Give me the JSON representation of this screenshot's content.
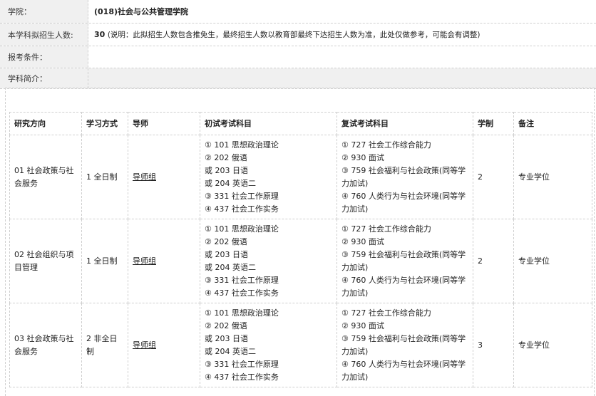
{
  "info": {
    "college_label": "学院：",
    "college_value": "(018)社会与公共管理学院",
    "enroll_label": "本学科拟招生人数:",
    "enroll_num": "30",
    "enroll_note": "(说明：此拟招生人数包含推免生，最终招生人数以教育部最终下达招生人数为准，此处仅做参考，可能会有调整)",
    "conditions_label": "报考条件：",
    "intro_label": "学科简介："
  },
  "table": {
    "headers": [
      "研究方向",
      "学习方式",
      "导师",
      "初试考试科目",
      "复试考试科目",
      "学制",
      "备注"
    ],
    "rows": [
      {
        "direction": "01 社会政策与社会服务",
        "mode": "1 全日制",
        "tutor": "导师组",
        "initial": [
          "① 101 思想政治理论",
          "② 202 俄语",
          "或 203 日语",
          "或 204 英语二",
          "③ 331 社会工作原理",
          "④ 437 社会工作实务"
        ],
        "retest": [
          "① 727 社会工作综合能力",
          "② 930 面试",
          "③ 759 社会福利与社会政策(同等学力加试)",
          "④ 760 人类行为与社会环境(同等学力加试)"
        ],
        "years": "2",
        "remark": "专业学位"
      },
      {
        "direction": "02 社会组织与项目管理",
        "mode": "1 全日制",
        "tutor": "导师组",
        "initial": [
          "① 101 思想政治理论",
          "② 202 俄语",
          "或 203 日语",
          "或 204 英语二",
          "③ 331 社会工作原理",
          "④ 437 社会工作实务"
        ],
        "retest": [
          "① 727 社会工作综合能力",
          "② 930 面试",
          "③ 759 社会福利与社会政策(同等学力加试)",
          "④ 760 人类行为与社会环境(同等学力加试)"
        ],
        "years": "2",
        "remark": "专业学位"
      },
      {
        "direction": "03 社会政策与社会服务",
        "mode": "2 非全日制",
        "tutor": "导师组",
        "initial": [
          "① 101 思想政治理论",
          "② 202 俄语",
          "或 203 日语",
          "或 204 英语二",
          "③ 331 社会工作原理",
          "④ 437 社会工作实务"
        ],
        "retest": [
          "① 727 社会工作综合能力",
          "② 930 面试",
          "③ 759 社会福利与社会政策(同等学力加试)",
          "④ 760 人类行为与社会环境(同等学力加试)"
        ],
        "years": "3",
        "remark": "专业学位"
      }
    ]
  }
}
